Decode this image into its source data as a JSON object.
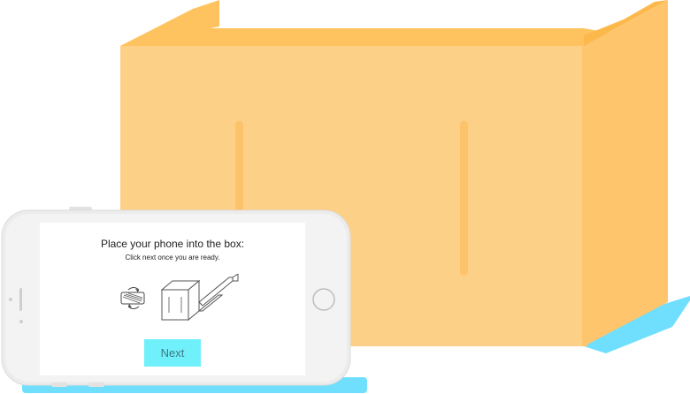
{
  "instructions": {
    "title": "Place your phone into the box:",
    "subtitle": "Click next once you are ready."
  },
  "actions": {
    "next_label": "Next"
  },
  "colors": {
    "box_front": "#fdd087",
    "box_side": "#fec56c",
    "box_flap": "#fec35e",
    "shadow": "#6fdffd",
    "phone_body": "#ececec",
    "next_button": "#6ff0fb"
  },
  "icons": {
    "rotate": "rotate-phone-icon",
    "box": "box-diagram-icon"
  }
}
